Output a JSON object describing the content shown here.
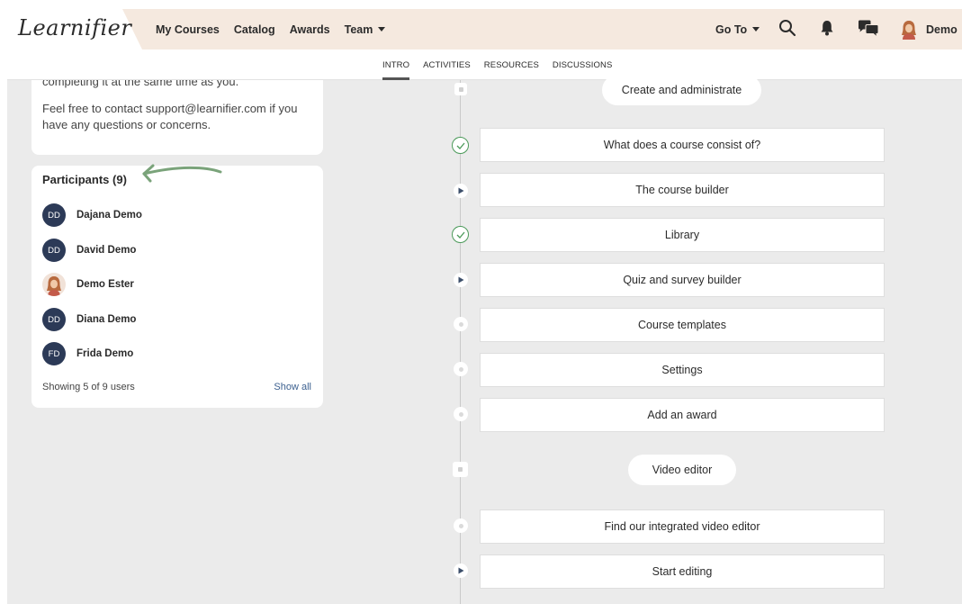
{
  "colors": {
    "header_bg": "#f5e9df",
    "canvas_bg": "#ebebeb",
    "avatar_bg": "#2c3a57",
    "check_green": "#4c9a5a",
    "link": "#3d6190",
    "arrow_green": "#7aa37a"
  },
  "header": {
    "logo": "Learnifier",
    "nav": [
      {
        "label": "My Courses"
      },
      {
        "label": "Catalog"
      },
      {
        "label": "Awards"
      },
      {
        "label": "Team",
        "dropdown": true
      }
    ],
    "goto_label": "Go To",
    "user_name": "Demo",
    "icons": [
      "search-icon",
      "bell-icon",
      "chat-icon",
      "chevron-down-icon"
    ]
  },
  "tabs": [
    {
      "label": "INTRO",
      "active": true
    },
    {
      "label": "ACTIVITIES"
    },
    {
      "label": "RESOURCES"
    },
    {
      "label": "DISCUSSIONS"
    }
  ],
  "intro_card": {
    "partial_line": "completing it at the same time as you.",
    "contact_text": "Feel free to contact support@learnifier.com if you have any questions or concerns."
  },
  "participants": {
    "title": "Participants (9)",
    "people": [
      {
        "initials": "DD",
        "name": "Dajana Demo",
        "photo": false
      },
      {
        "initials": "DD",
        "name": "David Demo",
        "photo": false
      },
      {
        "initials": "",
        "name": "Demo Ester",
        "photo": true
      },
      {
        "initials": "DD",
        "name": "Diana Demo",
        "photo": false
      },
      {
        "initials": "FD",
        "name": "Frida Demo",
        "photo": false
      }
    ],
    "showing_text": "Showing 5 of 9 users",
    "show_all_label": "Show all"
  },
  "timeline": {
    "sections": [
      {
        "label": "Create and administrate",
        "node": "square"
      },
      {
        "label": "Video editor",
        "node": "square"
      }
    ],
    "steps": [
      {
        "label": "What does a course consist of?",
        "status": "completed"
      },
      {
        "label": "The course builder",
        "status": "video"
      },
      {
        "label": "Library",
        "status": "completed"
      },
      {
        "label": "Quiz and survey builder",
        "status": "video"
      },
      {
        "label": "Course templates",
        "status": "not-started"
      },
      {
        "label": "Settings",
        "status": "not-started"
      },
      {
        "label": "Add an award",
        "status": "not-started"
      },
      {
        "label": "Find our integrated video editor",
        "status": "not-started"
      },
      {
        "label": "Start editing",
        "status": "video"
      }
    ]
  }
}
